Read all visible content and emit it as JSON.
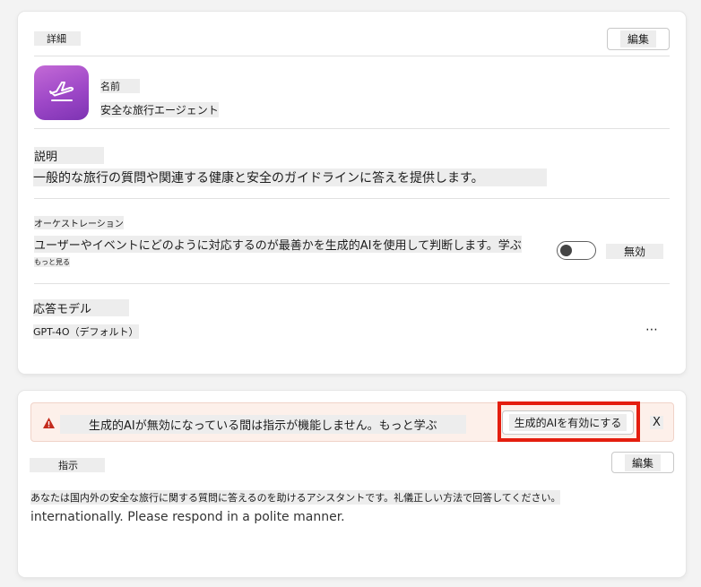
{
  "details": {
    "section_label": "詳細",
    "edit_label": "編集",
    "name_label": "名前",
    "name_value": "安全な旅行エージェント",
    "avatar_icon": "airplane-icon",
    "avatar_color": "#a24fcc"
  },
  "description": {
    "label": "説明",
    "text": "一般的な旅行の質問や関連する健康と安全のガイドラインに答えを提供します。"
  },
  "orchestration": {
    "label": "オーケストレーション",
    "text": "ユーザーやイベントにどのように対応するのが最善かを生成的AIを使用して判断します。学ぶ",
    "more_link": "もっと見る",
    "toggle_state": "無効",
    "toggle_on": false
  },
  "model": {
    "label": "応答モデル",
    "value": "GPT-4O（デフォルト）",
    "more_icon": "more-options-icon"
  },
  "warning": {
    "icon": "warning-icon",
    "icon_color": "#c42b1c",
    "text": "生成的AIが無効になっている間は指示が機能しません。もっと学ぶ",
    "enable_label": "生成的AIを有効にする",
    "close_label": "X"
  },
  "instructions": {
    "label": "指示",
    "edit_label": "編集",
    "text_line1": "あなたは国内外の安全な旅行に関する質問に答えるのを助けるアシスタントです。礼儀正しい方法で回答してください。",
    "text_line2": "internationally. Please respond in a polite manner."
  },
  "colors": {
    "highlight_box": "#e41e0f",
    "banner_bg": "#fdf0ea"
  }
}
